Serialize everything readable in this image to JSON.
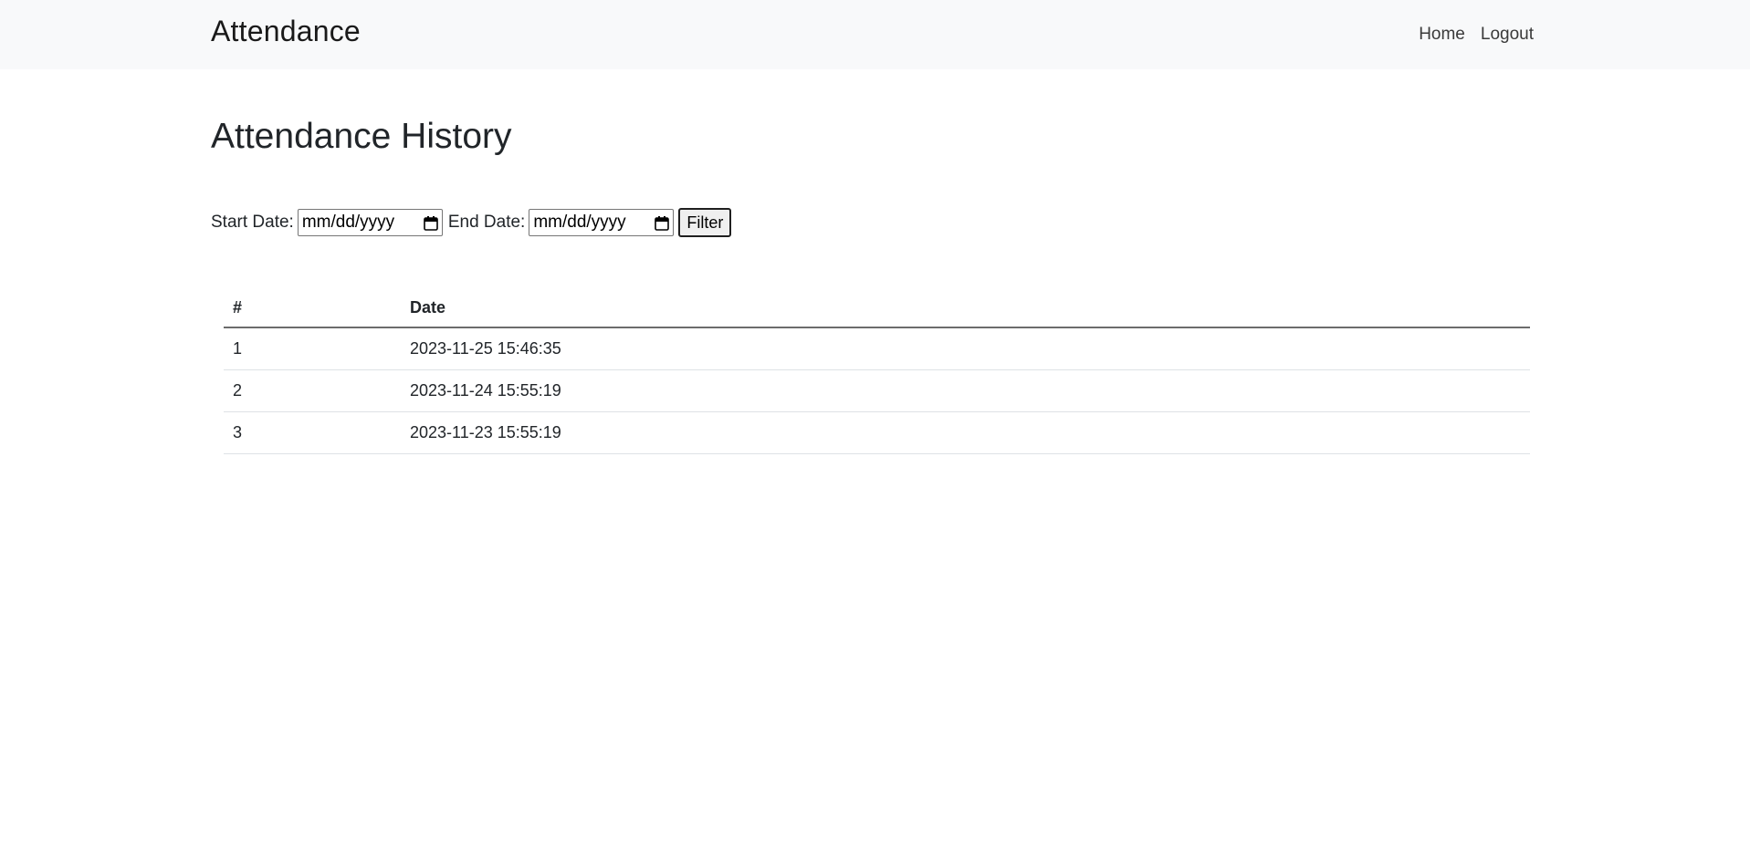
{
  "navbar": {
    "brand": "Attendance",
    "links": [
      "Home",
      "Logout"
    ]
  },
  "page": {
    "title": "Attendance History"
  },
  "filter": {
    "start_label": "Start Date:",
    "start_value": "mm/dd/yyyy",
    "end_label": "End Date:",
    "end_value": "mm/dd/yyyy",
    "button_label": "Filter",
    "icon": "calendar-icon"
  },
  "table": {
    "headers": [
      "#",
      "Date"
    ],
    "rows": [
      [
        "1",
        "2023-11-25 15:46:35"
      ],
      [
        "2",
        "2023-11-24 15:55:19"
      ],
      [
        "3",
        "2023-11-23 15:55:19"
      ]
    ]
  },
  "colors": {
    "navbar_bg": "#f8f9fa",
    "text": "#212529"
  }
}
